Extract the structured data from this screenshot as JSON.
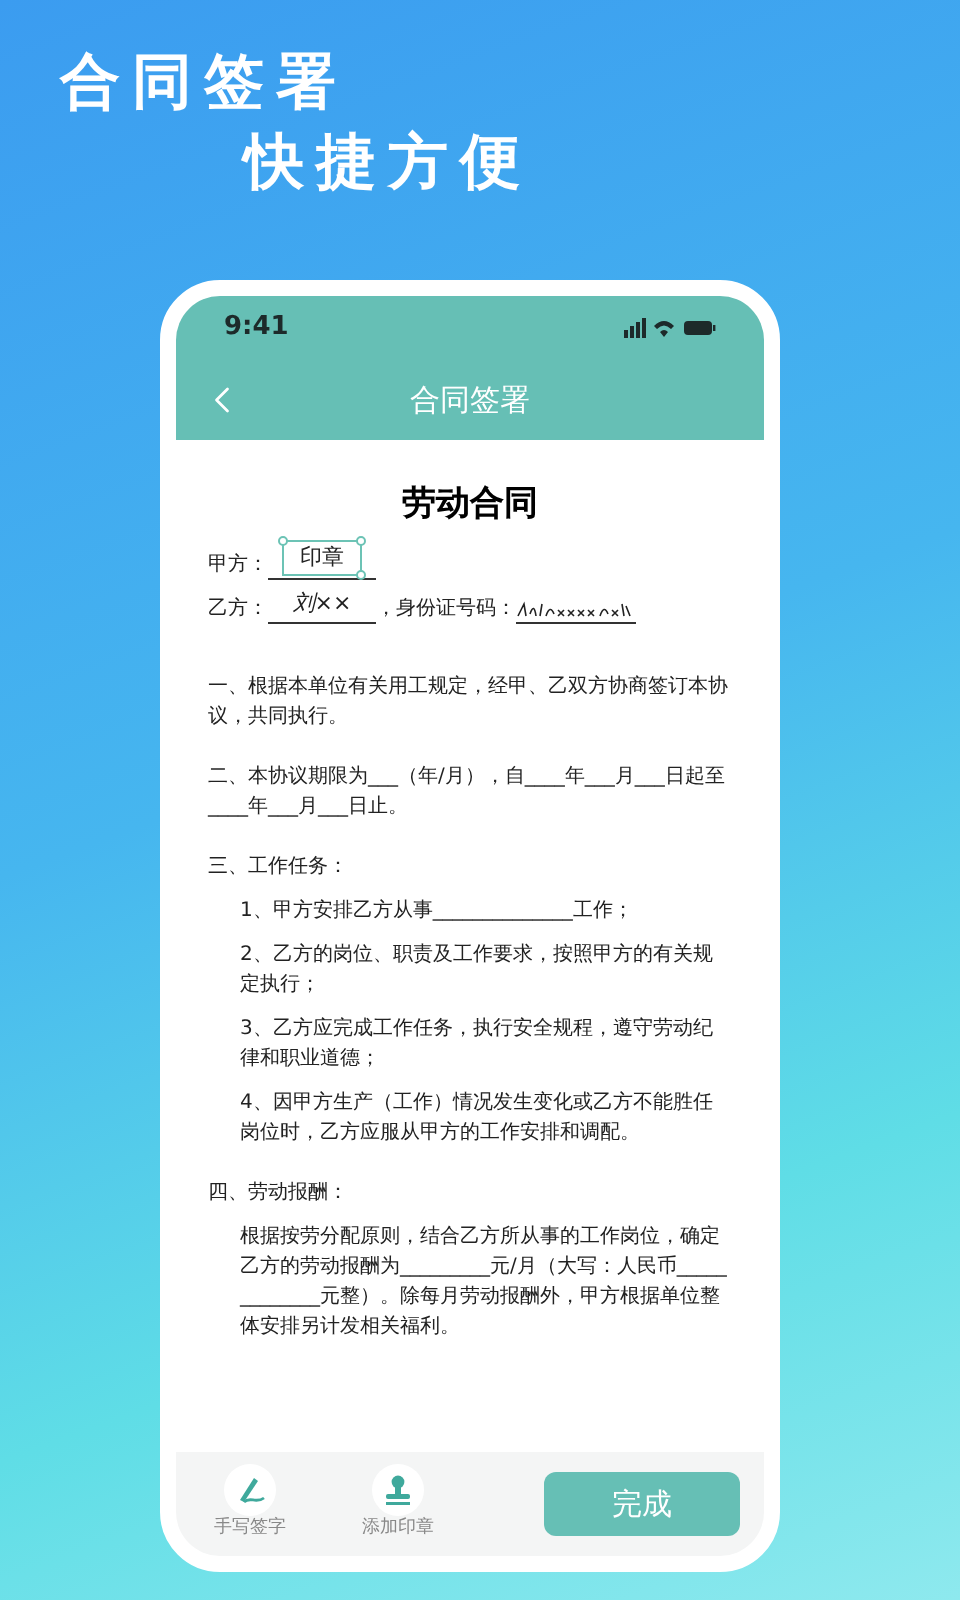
{
  "headline": [
    "合同签署",
    "快捷方便"
  ],
  "phone": {
    "time": "9:41",
    "nav_title": "合同签署"
  },
  "document": {
    "title": "劳动合同",
    "parties": [
      {
        "kind": "stamp",
        "label": "甲方：",
        "value": "印章"
      },
      {
        "kind": "signature",
        "label": "乙方：",
        "value": "刘××",
        "id_label": "，身份证号码："
      }
    ],
    "paragraphs": [
      {
        "kind": "heading",
        "text": "一、根据本单位有关用工规定，经甲、乙双方协商签订本协议，共同执行。"
      },
      {
        "kind": "heading",
        "text": "二、本协议期限为___（年/月），自____年___月___日起至____年___月___日止。"
      },
      {
        "kind": "heading",
        "text": "三、工作任务："
      },
      {
        "kind": "item",
        "text": "1、甲方安排乙方从事______________工作；"
      },
      {
        "kind": "item",
        "text": "2、乙方的岗位、职责及工作要求，按照甲方的有关规定执行；"
      },
      {
        "kind": "item",
        "text": "3、乙方应完成工作任务，执行安全规程，遵守劳动纪律和职业道德；"
      },
      {
        "kind": "item",
        "text": "4、因甲方生产（工作）情况发生变化或乙方不能胜任岗位时，乙方应服从甲方的工作安排和调配。"
      },
      {
        "kind": "heading",
        "text": "四、劳动报酬："
      },
      {
        "kind": "item",
        "text": "根据按劳分配原则，结合乙方所从事的工作岗位，确定乙方的劳动报酬为_________元/月（大写：人民币_____________元整）。除每月劳动报酬外，甲方根据单位整体安排另计发相关福利。"
      }
    ]
  },
  "toolbar": [
    {
      "kind": "pen",
      "label": "手写签字"
    },
    {
      "kind": "stamp",
      "label": "添加印章"
    }
  ],
  "done_button": "完成"
}
